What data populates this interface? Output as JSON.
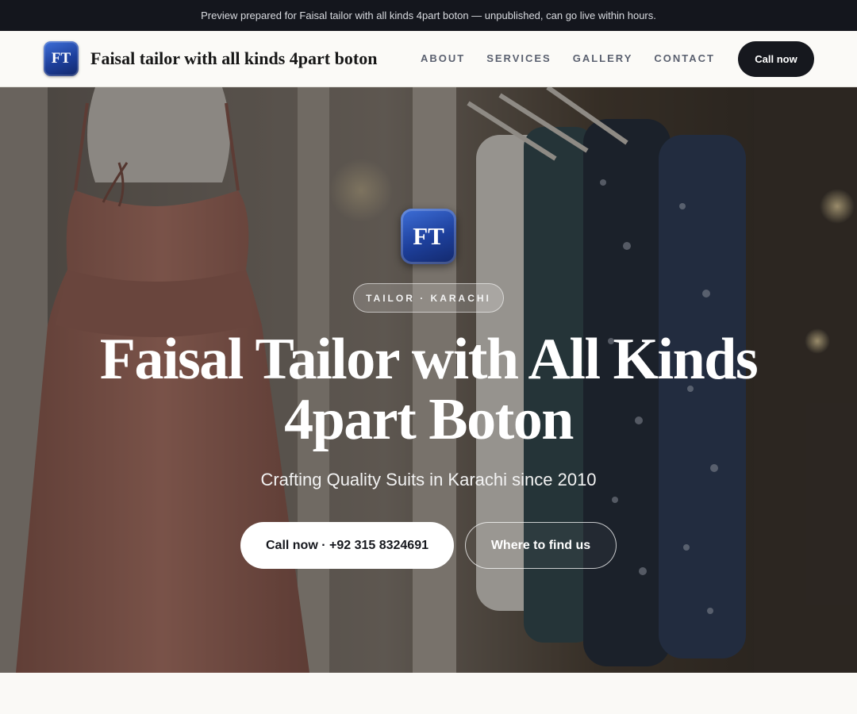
{
  "preview_banner": "Preview prepared for Faisal tailor with all kinds 4part boton — unpublished, can go live within hours.",
  "nav": {
    "logo_initials": "FT",
    "brand_name": "Faisal tailor with all kinds 4part boton",
    "links": [
      "ABOUT",
      "SERVICES",
      "GALLERY",
      "CONTACT"
    ],
    "cta_label": "Call now"
  },
  "hero": {
    "logo_initials": "FT",
    "badge": "TAILOR · KARACHI",
    "title_line1": "Faisal Tailor with All Kinds",
    "title_line2": "4part Boton",
    "subtitle": "Crafting Quality Suits in Karachi since 2010",
    "primary_button": "Call now · +92 315 8324691",
    "secondary_button": "Where to find us"
  },
  "colors": {
    "brand_blue": "#1d3f9b",
    "dark": "#16181e",
    "dress": "#a86a5e"
  }
}
